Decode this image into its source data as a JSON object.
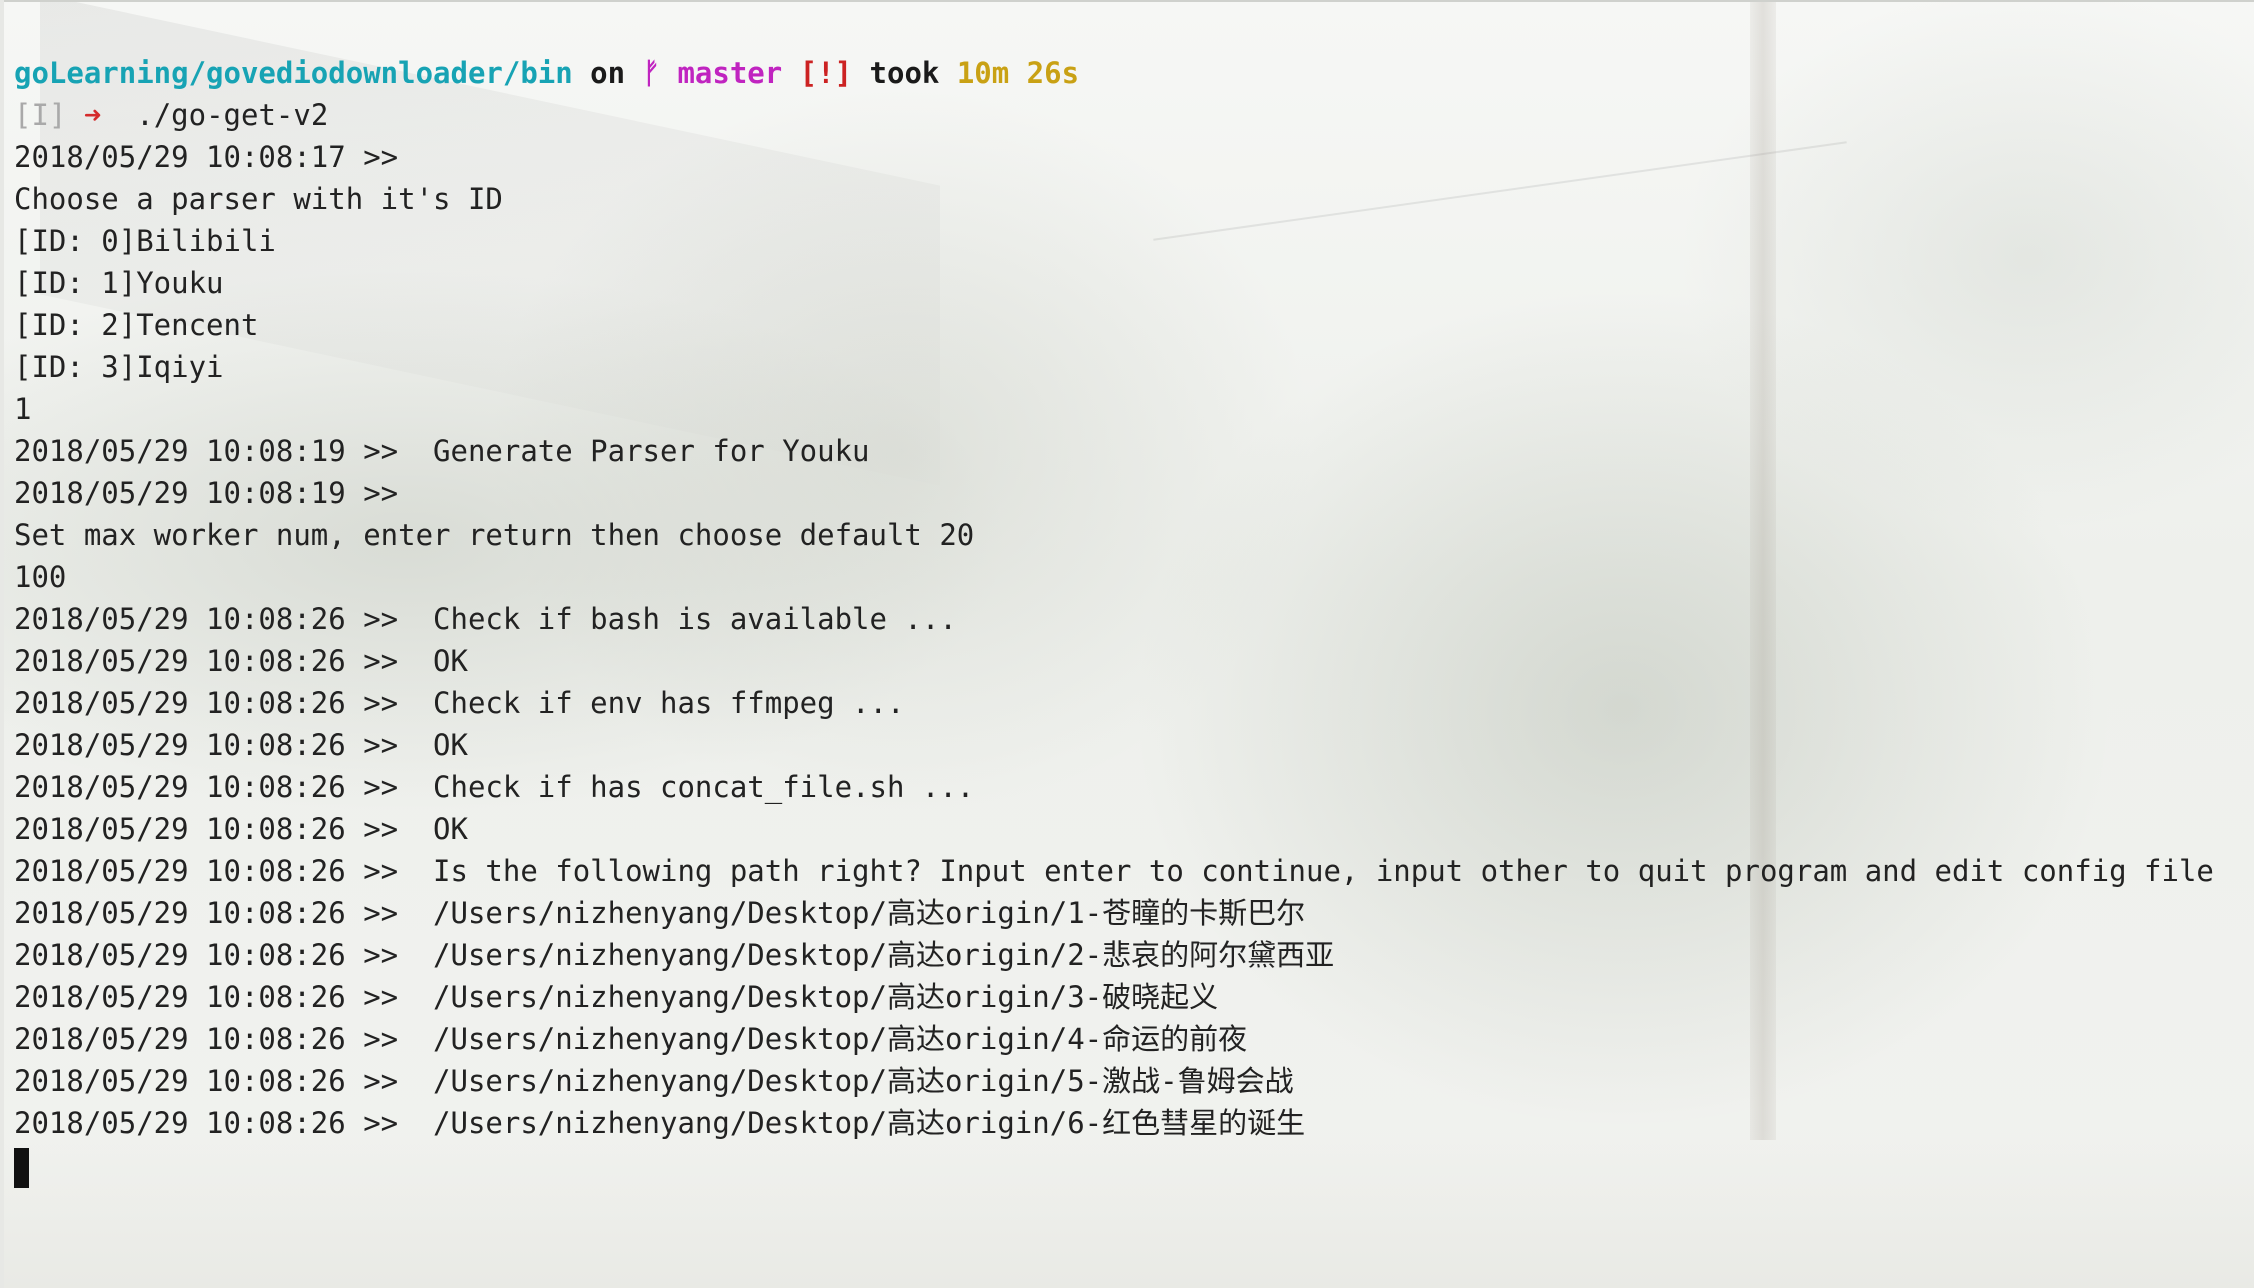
{
  "prompt": {
    "path": "goLearning/govediodownloader/bin",
    "on_text": "on",
    "branch_icon": "git-branch-icon",
    "branch_glyph": "ᚠ",
    "branch": "master",
    "status": "[!]",
    "took_text": "took",
    "duration": "10m 26s"
  },
  "command_line": {
    "mode": "[I]",
    "arrow": "➜",
    "command": "./go-get-v2"
  },
  "output_lines": [
    "2018/05/29 10:08:17 >>",
    "Choose a parser with it's ID",
    "[ID: 0]Bilibili",
    "[ID: 1]Youku",
    "[ID: 2]Tencent",
    "[ID: 3]Iqiyi",
    "1",
    "2018/05/29 10:08:19 >>  Generate Parser for Youku",
    "2018/05/29 10:08:19 >>",
    "Set max worker num, enter return then choose default 20",
    "100",
    "2018/05/29 10:08:26 >>  Check if bash is available ...",
    "2018/05/29 10:08:26 >>  OK",
    "2018/05/29 10:08:26 >>  Check if env has ffmpeg ...",
    "2018/05/29 10:08:26 >>  OK",
    "2018/05/29 10:08:26 >>  Check if has concat_file.sh ...",
    "2018/05/29 10:08:26 >>  OK",
    "2018/05/29 10:08:26 >>  Is the following path right? Input enter to continue, input other to quit program and edit config file",
    "2018/05/29 10:08:26 >>  /Users/nizhenyang/Desktop/高达origin/1-苍瞳的卡斯巴尔",
    "2018/05/29 10:08:26 >>  /Users/nizhenyang/Desktop/高达origin/2-悲哀的阿尔黛西亚",
    "2018/05/29 10:08:26 >>  /Users/nizhenyang/Desktop/高达origin/3-破晓起义",
    "2018/05/29 10:08:26 >>  /Users/nizhenyang/Desktop/高达origin/4-命运的前夜",
    "2018/05/29 10:08:26 >>  /Users/nizhenyang/Desktop/高达origin/5-激战-鲁姆会战",
    "2018/05/29 10:08:26 >>  /Users/nizhenyang/Desktop/高达origin/6-红色彗星的诞生"
  ],
  "colors": {
    "path": "#17a3b4",
    "branch": "#c024c0",
    "status": "#cc2222",
    "duration": "#c9a114",
    "text": "#222222",
    "mode": "#a9a9a9",
    "arrow": "#d52b2b"
  }
}
